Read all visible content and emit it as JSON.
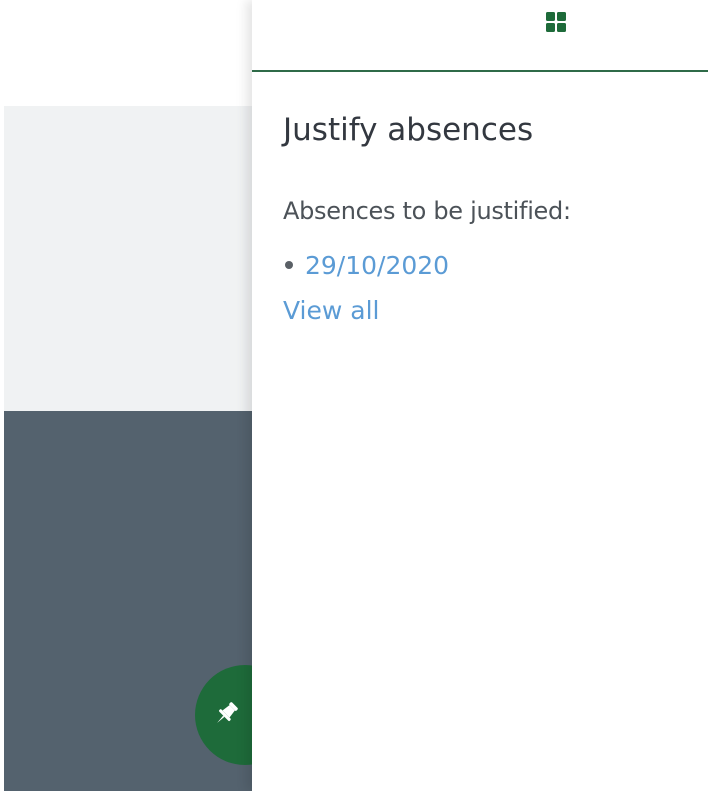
{
  "panel": {
    "header": {
      "icon": "grid-icon",
      "icon_color": "#1e6b3a"
    },
    "title": "Justify absences",
    "subtitle": "Absences to be justified:",
    "absences": [
      {
        "date": "29/10/2020"
      }
    ],
    "view_all_label": "View all"
  },
  "floating_button": {
    "icon": "pin-icon",
    "color": "#1e6b3a"
  },
  "colors": {
    "accent": "#2f6b48",
    "link": "#5b9bd5",
    "background_light": "#f0f2f3",
    "background_dark": "#54626e"
  }
}
